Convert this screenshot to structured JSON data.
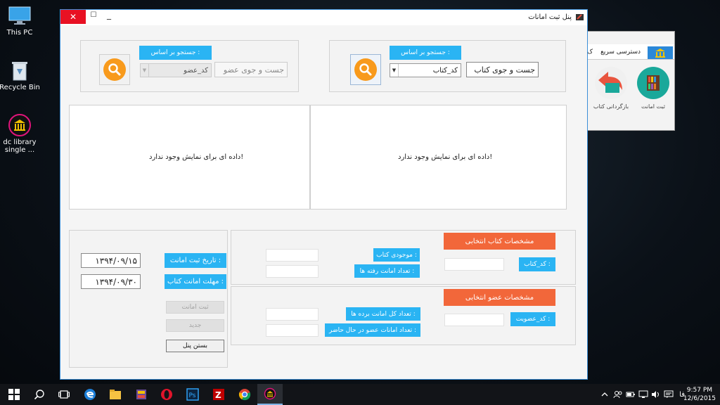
{
  "desktop": {
    "icons": [
      {
        "label": "This PC"
      },
      {
        "label": "Recycle Bin"
      },
      {
        "label": "dc library single ..."
      }
    ]
  },
  "background_window": {
    "tab_active": "",
    "tab_label": "دسترسی سریع",
    "tab_label_cut": "ک",
    "button_register": "ثبت امانت",
    "button_return": "بازگردانی کتاب"
  },
  "window": {
    "title": "پنل ثبت امانات",
    "close_symbol": "✕",
    "maximize_symbol": "☐",
    "minimize_symbol": "_"
  },
  "book_search": {
    "label": "جستجو بر اساس :",
    "input_value": "جست و جوی کتاب",
    "combo_value": "کد_کتاب",
    "no_data": "داده ای برای نمایش وجود ندارد!"
  },
  "member_search": {
    "label": "جستجو بر اساس :",
    "input_value": "جست و جوی عضو",
    "combo_value": "کد_عضو",
    "no_data": "داده ای برای نمایش وجود ندارد!"
  },
  "book_details": {
    "header": "مشخصات کتاب انتخابی",
    "stock_label": "موجودی کتاب :",
    "loaned_label": "تعداد امانت رفته ها :",
    "code_label": "کد_کتاب :"
  },
  "member_details": {
    "header": "مشخصات عضو انتخابی",
    "total_loans_label": "تعداد کل امانت برده ها :",
    "current_loans_label": "تعداد امانات عضو در حال حاضر :",
    "code_label": "کد_عضویت :"
  },
  "loan_form": {
    "date_label": "تاریخ ثبت امانت :",
    "date_value": "۱۳۹۴/۰۹/۱۵",
    "due_label": "مهلت امانت کتاب :",
    "due_value": "۱۳۹۴/۰۹/۳۰",
    "register_button": "ثبت امانت",
    "new_button": "جدید",
    "close_button": "بستن پنل"
  },
  "taskbar": {
    "language": "فا",
    "time": "9:57 PM",
    "date": "12/6/2015"
  },
  "colors": {
    "accent_blue": "#2ab4f3",
    "accent_orange": "#f2673a",
    "search_orange": "#f89a1c",
    "close_red": "#e81123"
  }
}
